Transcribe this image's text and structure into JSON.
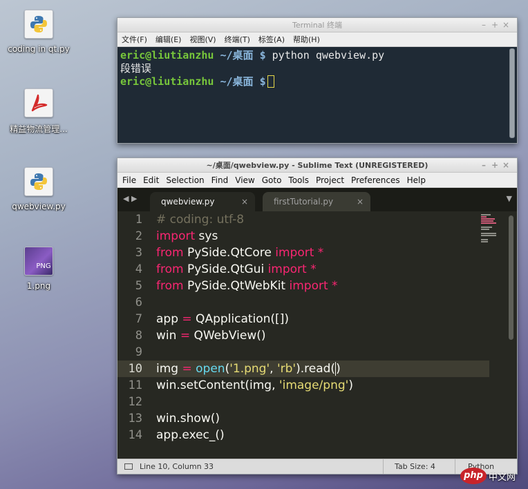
{
  "desktop": {
    "icons": [
      {
        "label": "coding in qt.py",
        "icon": "python-file-icon"
      },
      {
        "label": "精益物流管理...",
        "icon": "pdf-file-icon"
      },
      {
        "label": "qwebview.py",
        "icon": "python-file-icon"
      },
      {
        "label": "1.png",
        "icon": "png-image-icon",
        "badge": "PNG"
      }
    ]
  },
  "terminal": {
    "title": "Terminal 终端",
    "window_buttons": [
      "–",
      "+",
      "×"
    ],
    "menu": [
      "文件(F)",
      "编辑(E)",
      "视图(V)",
      "终端(T)",
      "标签(A)",
      "帮助(H)"
    ],
    "lines": [
      {
        "user": "eric@liutianzhu",
        "path": "~/桌面",
        "prompt": "$",
        "command": "python qwebview.py"
      },
      {
        "output": "段错误"
      },
      {
        "user": "eric@liutianzhu",
        "path": "~/桌面",
        "prompt": "$",
        "command": ""
      }
    ]
  },
  "sublime": {
    "title": "~/桌面/qwebview.py - Sublime Text (UNREGISTERED)",
    "window_buttons": [
      "–",
      "+",
      "×"
    ],
    "menu": [
      "File",
      "Edit",
      "Selection",
      "Find",
      "View",
      "Goto",
      "Tools",
      "Project",
      "Preferences",
      "Help"
    ],
    "tabs": [
      {
        "label": "qwebview.py",
        "active": true,
        "close": "×"
      },
      {
        "label": "firstTutorial.py",
        "active": false,
        "close": "×"
      }
    ],
    "tab_nav": "◀ ▶",
    "tab_menu": "▼",
    "line_numbers": [
      "1",
      "2",
      "3",
      "4",
      "5",
      "6",
      "7",
      "8",
      "9",
      "10",
      "11",
      "12",
      "13",
      "14"
    ],
    "current_line": 10,
    "code": {
      "l1": "# coding: utf-8",
      "l2_kw": "import",
      "l2_rest": " sys",
      "l3_kw": "from",
      "l3_mod": " PySide.QtCore ",
      "l3_kw2": "import",
      "l3_star": " *",
      "l4_kw": "from",
      "l4_mod": " PySide.QtGui ",
      "l4_kw2": "import",
      "l4_star": " *",
      "l5_kw": "from",
      "l5_mod": " PySide.QtWebKit ",
      "l5_kw2": "import",
      "l5_star": " *",
      "l7_a": "app ",
      "l7_op": "=",
      "l7_b": " QApplication([])",
      "l8_a": "win ",
      "l8_op": "=",
      "l8_b": " QWebView()",
      "l10_a": "img ",
      "l10_op": "=",
      "l10_fn": " open",
      "l10_p1": "(",
      "l10_s1": "'1.png'",
      "l10_c": ", ",
      "l10_s2": "'rb'",
      "l10_p2": ").read(",
      "l10_end": ")",
      "l11_a": "win.setContent(img, ",
      "l11_s": "'image/png'",
      "l11_b": ")",
      "l13": "win.show()",
      "l14": "app.exec_()"
    },
    "status": {
      "position": "Line 10, Column 33",
      "tab_size": "Tab Size: 4",
      "syntax": "Python"
    }
  },
  "watermark": {
    "logo": "php",
    "text": "中文网"
  },
  "colors": {
    "keyword": "#f92672",
    "string": "#e6db74",
    "comment": "#75715e",
    "builtin": "#66d9ef",
    "terminal_user": "#77c63b",
    "terminal_path": "#8ab6dc"
  }
}
